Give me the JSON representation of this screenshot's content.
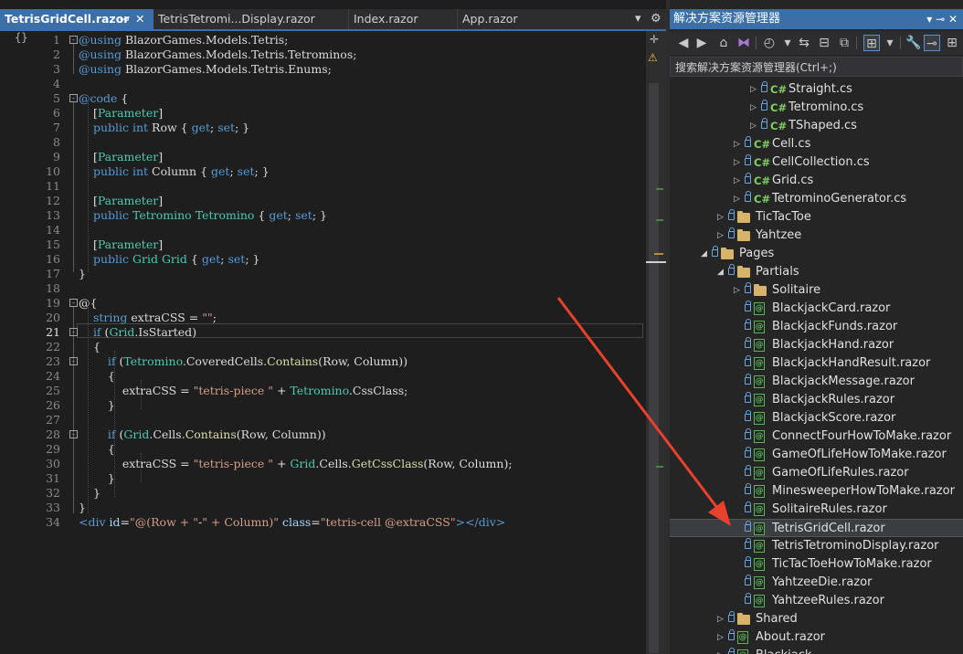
{
  "editor": {
    "tabs": [
      {
        "label": "TetrisGridCell.razor",
        "active": true
      },
      {
        "label": "TetrisTetromi...Display.razor",
        "active": false
      },
      {
        "label": "Index.razor",
        "active": false
      },
      {
        "label": "App.razor",
        "active": false
      }
    ],
    "pin_icon": "⊸",
    "close_icon": "✕",
    "dropdown_icon": "▾",
    "settings_icon": "⚙",
    "nav_glyph": "{}",
    "split_icon": "✛",
    "warning_icon": "⚠",
    "current_line": 21,
    "lines": [
      {
        "n": "1",
        "fold": "-",
        "text": "@using BlazorGames.Models.Tetris;"
      },
      {
        "n": "2",
        "text": "@using BlazorGames.Models.Tetris.Tetrominos;"
      },
      {
        "n": "3",
        "text": "@using BlazorGames.Models.Tetris.Enums;"
      },
      {
        "n": "4",
        "text": ""
      },
      {
        "n": "5",
        "fold": "-",
        "text": "@code {"
      },
      {
        "n": "6",
        "text": "    [Parameter]"
      },
      {
        "n": "7",
        "text": "    public int Row { get; set; }"
      },
      {
        "n": "8",
        "text": ""
      },
      {
        "n": "9",
        "text": "    [Parameter]"
      },
      {
        "n": "10",
        "text": "    public int Column { get; set; }"
      },
      {
        "n": "11",
        "text": ""
      },
      {
        "n": "12",
        "text": "    [Parameter]"
      },
      {
        "n": "13",
        "text": "    public Tetromino Tetromino { get; set; }"
      },
      {
        "n": "14",
        "text": ""
      },
      {
        "n": "15",
        "text": "    [Parameter]"
      },
      {
        "n": "16",
        "text": "    public Grid Grid { get; set; }"
      },
      {
        "n": "17",
        "text": "}"
      },
      {
        "n": "18",
        "text": ""
      },
      {
        "n": "19",
        "fold": "-",
        "text": "@{"
      },
      {
        "n": "20",
        "text": "    string extraCSS = \"\";"
      },
      {
        "n": "21",
        "fold": "-",
        "text": "    if (Grid.IsStarted)"
      },
      {
        "n": "22",
        "text": "    {"
      },
      {
        "n": "23",
        "fold": "-",
        "text": "        if (Tetromino.CoveredCells.Contains(Row, Column))"
      },
      {
        "n": "24",
        "text": "        {"
      },
      {
        "n": "25",
        "text": "            extraCSS = \"tetris-piece \" + Tetromino.CssClass;"
      },
      {
        "n": "26",
        "text": "        }"
      },
      {
        "n": "27",
        "text": ""
      },
      {
        "n": "28",
        "fold": "-",
        "text": "        if (Grid.Cells.Contains(Row, Column))"
      },
      {
        "n": "29",
        "text": "        {"
      },
      {
        "n": "30",
        "text": "            extraCSS = \"tetris-piece \" + Grid.Cells.GetCssClass(Row, Column);"
      },
      {
        "n": "31",
        "text": "        }"
      },
      {
        "n": "32",
        "text": "    }"
      },
      {
        "n": "33",
        "text": "}"
      },
      {
        "n": "34",
        "text": "<div id=\"@(Row + \"-\" + Column)\" class=\"tetris-cell @extraCSS\"></div>"
      }
    ]
  },
  "solution_explorer": {
    "title": "解决方案资源管理器",
    "title_controls": "▾ ⊸ ✕",
    "search_placeholder": "搜索解决方案资源管理器(Ctrl+;)",
    "toolbar_icons": [
      "back-icon",
      "forward-icon",
      "home-icon",
      "vs-icon",
      "history-icon",
      "sync-icon",
      "collapse-icon",
      "copy-icon",
      "view-icon",
      "wrench-icon",
      "preview-icon",
      "pin-icon"
    ],
    "tree": [
      {
        "label": "Straight.cs",
        "type": "cs",
        "depth": 4,
        "arrow": "▷"
      },
      {
        "label": "Tetromino.cs",
        "type": "cs",
        "depth": 4,
        "arrow": "▷"
      },
      {
        "label": "TShaped.cs",
        "type": "cs",
        "depth": 4,
        "arrow": "▷"
      },
      {
        "label": "Cell.cs",
        "type": "cs",
        "depth": 3,
        "arrow": "▷"
      },
      {
        "label": "CellCollection.cs",
        "type": "cs",
        "depth": 3,
        "arrow": "▷"
      },
      {
        "label": "Grid.cs",
        "type": "cs",
        "depth": 3,
        "arrow": "▷"
      },
      {
        "label": "TetrominoGenerator.cs",
        "type": "cs",
        "depth": 3,
        "arrow": "▷"
      },
      {
        "label": "TicTacToe",
        "type": "folder",
        "depth": 2,
        "arrow": "▷"
      },
      {
        "label": "Yahtzee",
        "type": "folder",
        "depth": 2,
        "arrow": "▷"
      },
      {
        "label": "Pages",
        "type": "folder",
        "depth": 1,
        "arrow": "◢"
      },
      {
        "label": "Partials",
        "type": "folder",
        "depth": 2,
        "arrow": "◢"
      },
      {
        "label": "Solitaire",
        "type": "folder",
        "depth": 3,
        "arrow": "▷"
      },
      {
        "label": "BlackjackCard.razor",
        "type": "razor",
        "depth": 3
      },
      {
        "label": "BlackjackFunds.razor",
        "type": "razor",
        "depth": 3
      },
      {
        "label": "BlackjackHand.razor",
        "type": "razor",
        "depth": 3
      },
      {
        "label": "BlackjackHandResult.razor",
        "type": "razor",
        "depth": 3
      },
      {
        "label": "BlackjackMessage.razor",
        "type": "razor",
        "depth": 3
      },
      {
        "label": "BlackjackRules.razor",
        "type": "razor",
        "depth": 3
      },
      {
        "label": "BlackjackScore.razor",
        "type": "razor",
        "depth": 3
      },
      {
        "label": "ConnectFourHowToMake.razor",
        "type": "razor",
        "depth": 3
      },
      {
        "label": "GameOfLifeHowToMake.razor",
        "type": "razor",
        "depth": 3
      },
      {
        "label": "GameOfLifeRules.razor",
        "type": "razor",
        "depth": 3
      },
      {
        "label": "MinesweeperHowToMake.razor",
        "type": "razor",
        "depth": 3
      },
      {
        "label": "SolitaireRules.razor",
        "type": "razor",
        "depth": 3
      },
      {
        "label": "TetrisGridCell.razor",
        "type": "razor",
        "depth": 3,
        "selected": true
      },
      {
        "label": "TetrisTetrominoDisplay.razor",
        "type": "razor",
        "depth": 3
      },
      {
        "label": "TicTacToeHowToMake.razor",
        "type": "razor",
        "depth": 3
      },
      {
        "label": "YahtzeeDie.razor",
        "type": "razor",
        "depth": 3
      },
      {
        "label": "YahtzeeRules.razor",
        "type": "razor",
        "depth": 3
      },
      {
        "label": "Shared",
        "type": "folder",
        "depth": 2,
        "arrow": "▷"
      },
      {
        "label": "About.razor",
        "type": "razor",
        "depth": 2,
        "arrow": "▷"
      },
      {
        "label": "Blackjack...",
        "type": "razor",
        "depth": 2,
        "arrow": "▷"
      }
    ]
  },
  "colors": {
    "accent": "#3c6fa8",
    "annotation_arrow": "#e8412c",
    "keyword": "#569cd6",
    "type": "#4ec9b0",
    "string": "#d69d85"
  }
}
